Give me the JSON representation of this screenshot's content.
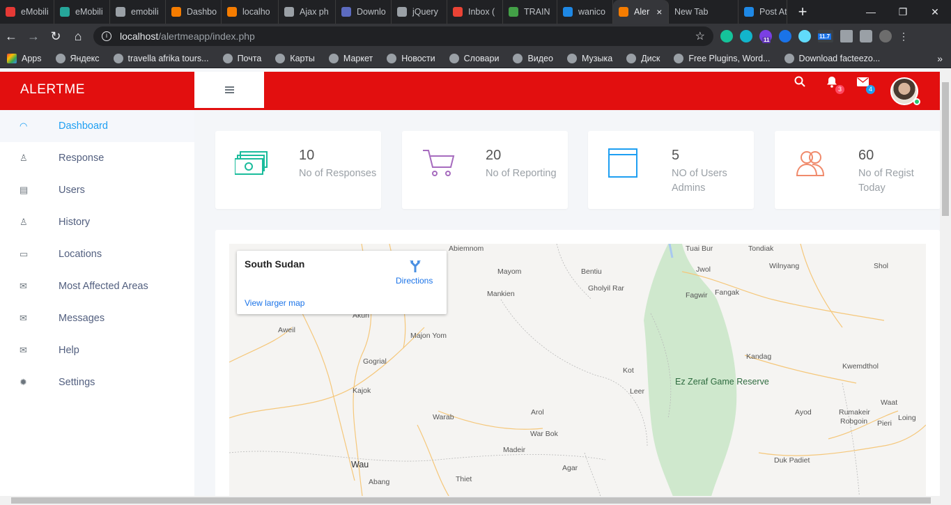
{
  "browser": {
    "tabs": [
      {
        "label": "eMobili",
        "color": "#e53935"
      },
      {
        "label": "eMobili",
        "color": "#26a69a"
      },
      {
        "label": "emobili",
        "color": "#9aa0a6"
      },
      {
        "label": "Dashbo",
        "color": "#f57c00"
      },
      {
        "label": "localho",
        "color": "#f57c00"
      },
      {
        "label": "Ajax ph",
        "color": "#9aa0a6"
      },
      {
        "label": "Downlo",
        "color": "#5c6bc0"
      },
      {
        "label": "jQuery",
        "color": "#9aa0a6"
      },
      {
        "label": "Inbox (",
        "color": "#ea4335"
      },
      {
        "label": "TRAIN",
        "color": "#43a047"
      },
      {
        "label": "wanico",
        "color": "#1e88e5"
      },
      {
        "label": "Aler",
        "color": "#f57c00"
      },
      {
        "label": "New Tab",
        "color": ""
      },
      {
        "label": "Post Att",
        "color": "#1e88e5"
      }
    ],
    "url_host": "localhost",
    "url_path": "/alertmeapp/index.php",
    "extension_badge_1": "11",
    "extension_badge_2": "11.7",
    "bookmarks": [
      "Apps",
      "Яндекс",
      "travella afrika tours...",
      "Почта",
      "Карты",
      "Маркет",
      "Новости",
      "Словари",
      "Видео",
      "Музыка",
      "Диск",
      "Free Plugins, Word...",
      "Download facteezo..."
    ]
  },
  "app": {
    "brand": "ALERTME",
    "notifications_count": "3",
    "messages_count": "4",
    "accent": "#e20f0f"
  },
  "sidebar": {
    "items": [
      {
        "label": "Dashboard",
        "icon": "speedometer-icon",
        "active": true
      },
      {
        "label": "Response",
        "icon": "user-icon"
      },
      {
        "label": "Users",
        "icon": "archive-icon"
      },
      {
        "label": "History",
        "icon": "user-icon"
      },
      {
        "label": "Locations",
        "icon": "comment-icon"
      },
      {
        "label": "Most Affected Areas",
        "icon": "envelope-icon"
      },
      {
        "label": "Messages",
        "icon": "envelope-icon"
      },
      {
        "label": "Help",
        "icon": "envelope-icon"
      },
      {
        "label": "Settings",
        "icon": "gear-icon"
      }
    ]
  },
  "cards": [
    {
      "value": "10",
      "label": "No of Responses",
      "icon": "money-icon",
      "color": "#1abc9c"
    },
    {
      "value": "20",
      "label": "No of Reporting",
      "icon": "cart-icon",
      "color": "#a66bbe"
    },
    {
      "value": "5",
      "label": "NO of Users Admins",
      "icon": "browser-window-icon",
      "color": "#1e9ff2"
    },
    {
      "value": "60",
      "label": "No of Regist Today",
      "icon": "users-icon",
      "color": "#f08a6b"
    }
  ],
  "map": {
    "popup_title": "South Sudan",
    "directions_label": "Directions",
    "larger_map_label": "View larger map",
    "places": [
      "Abiemnom",
      "Tuai Bur",
      "Tondiak",
      "Mayom",
      "Bentiu",
      "Jwol",
      "Wilnyang",
      "Shol",
      "Gholyil Rar",
      "Mankien",
      "Fagwir",
      "Fangak",
      "Akun",
      "Aweil",
      "Majon Yom",
      "Gogrial",
      "Kandag",
      "Kwemdthol",
      "Kot",
      "Kajok",
      "Leer",
      "Ez Zeraf Game Reserve",
      "Waat",
      "Warab",
      "Arol",
      "Ayod",
      "Rumakeir",
      "Robgoin",
      "Pieri",
      "Loing",
      "War Bok",
      "Madeir",
      "Agar",
      "Duk Padiet",
      "Wau",
      "Abang",
      "Thiet"
    ]
  }
}
